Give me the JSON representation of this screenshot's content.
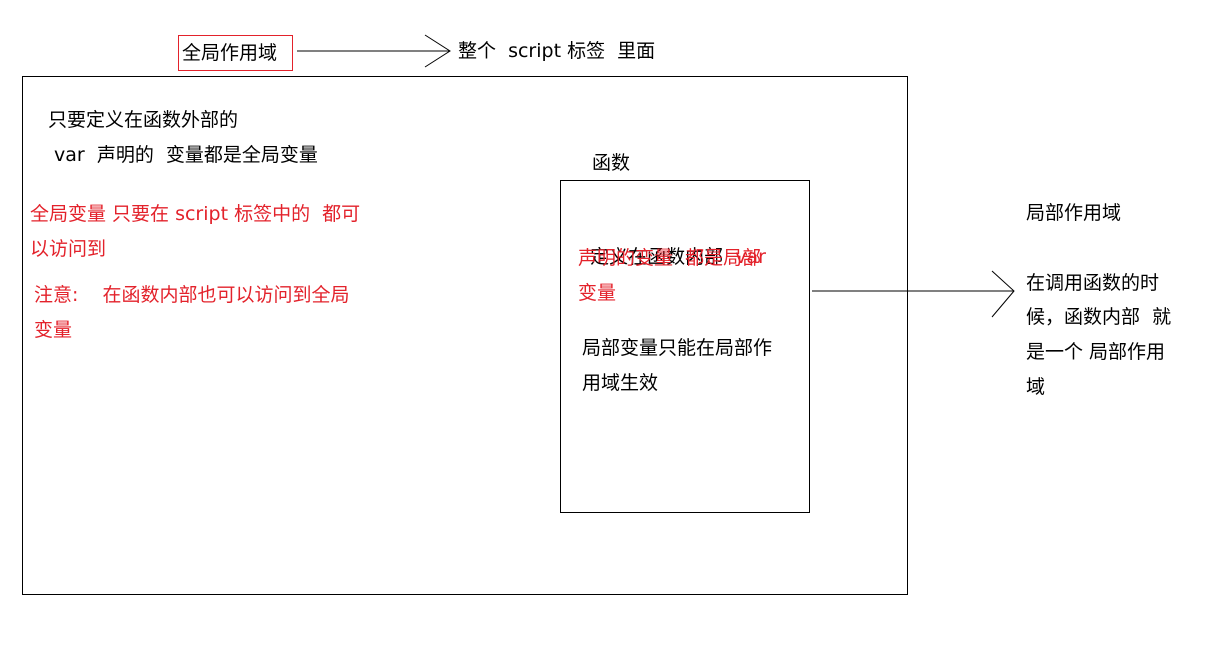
{
  "colors": {
    "accent": "#e3222b",
    "ink": "#000000"
  },
  "header": {
    "global_scope_label": "全局作用域",
    "global_scope_desc": "整个  script 标签  里面"
  },
  "global_area": {
    "line1": "只要定义在函数外部的",
    "line2": " var  声明的  变量都是全局变量",
    "red_note1_line1": "全局变量 只要在 script 标签中的  都可",
    "red_note1_line2": "以访问到",
    "red_note2_line1": "注意:    在函数内部也可以访问到全局",
    "red_note2_line2": "变量"
  },
  "function_area": {
    "title": "函数",
    "line1_black": "定义在函数内部  ",
    "line1_red": "var",
    "line2_red": "声明的变量  都是局部",
    "line3_red": "变量",
    "line4": "局部变量只能在局部作",
    "line5": "用域生效"
  },
  "local_scope": {
    "label": "局部作用域",
    "desc_line1": "在调用函数的时",
    "desc_line2": "候，函数内部  就",
    "desc_line3": "是一个 局部作用",
    "desc_line4": "域"
  }
}
